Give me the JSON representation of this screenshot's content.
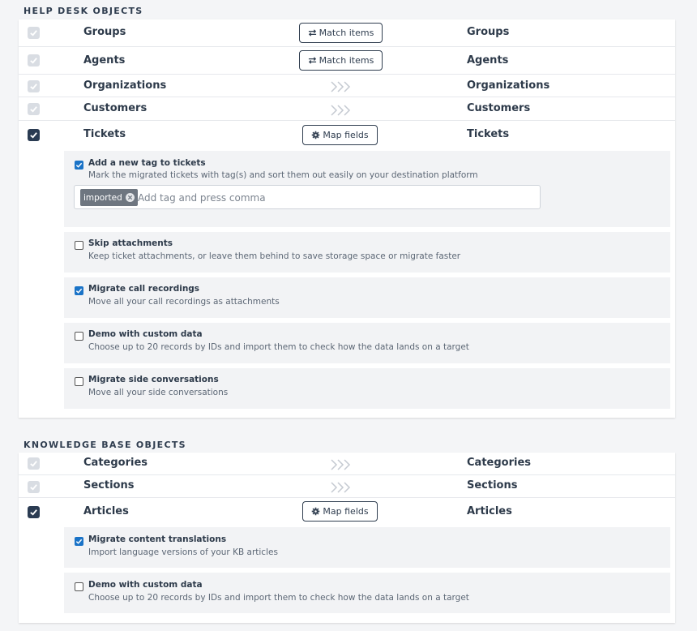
{
  "help_desk": {
    "heading": "HELP DESK OBJECTS",
    "rows": [
      {
        "name": "Groups",
        "target": "Groups",
        "action": "Match items"
      },
      {
        "name": "Agents",
        "target": "Agents",
        "action": "Match items"
      },
      {
        "name": "Organizations",
        "target": "Organizations"
      },
      {
        "name": "Customers",
        "target": "Customers"
      },
      {
        "name": "Tickets",
        "target": "Tickets",
        "action": "Map fields"
      }
    ],
    "options": [
      {
        "title": "Add a new tag to tickets",
        "desc": "Mark the migrated tickets with tag(s) and sort them out easily on your destination platform",
        "checked": true
      },
      {
        "title": "Skip attachments",
        "desc": "Keep ticket attachments, or leave them behind to save storage space or migrate faster",
        "checked": false
      },
      {
        "title": "Migrate call recordings",
        "desc": "Move all your call recordings as attachments",
        "checked": true
      },
      {
        "title": "Demo with custom data",
        "desc": "Choose up to 20 records by IDs and import them to check how the data lands on a target",
        "checked": false
      },
      {
        "title": "Migrate side conversations",
        "desc": "Move all your side conversations",
        "checked": false
      }
    ],
    "tag_input": {
      "tag": "imported",
      "placeholder": "Add tag and press comma",
      "value": ""
    }
  },
  "knowledge_base": {
    "heading": "KNOWLEDGE BASE OBJECTS",
    "rows": [
      {
        "name": "Categories",
        "target": "Categories"
      },
      {
        "name": "Sections",
        "target": "Sections"
      },
      {
        "name": "Articles",
        "target": "Articles",
        "action": "Map fields"
      }
    ],
    "options": [
      {
        "title": "Migrate content translations",
        "desc": "Import language versions of your KB articles",
        "checked": true
      },
      {
        "title": "Demo with custom data",
        "desc": "Choose up to 20 records by IDs and import them to check how the data lands on a target",
        "checked": false
      }
    ]
  },
  "colors": {
    "primary": "#2a3b52",
    "checkbox_on": "#1a73c7",
    "disabled": "#d9dde3",
    "option_bg": "#f2f3f5"
  }
}
